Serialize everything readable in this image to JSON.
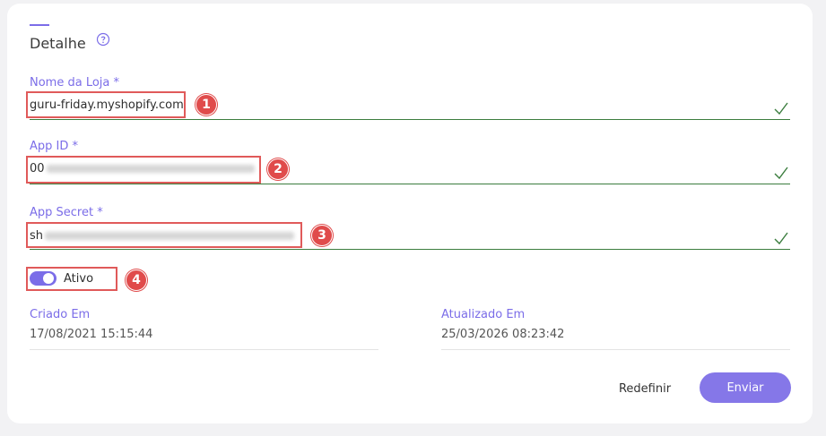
{
  "section": {
    "title": "Detalhe"
  },
  "fields": {
    "store_name": {
      "label": "Nome da Loja *",
      "value": "guru-friday.myshopify.com"
    },
    "app_id": {
      "label": "App ID *",
      "value_prefix": "00"
    },
    "app_secret": {
      "label": "App Secret *",
      "value_prefix": "sh"
    }
  },
  "toggle": {
    "label": "Ativo",
    "checked": true
  },
  "meta": {
    "created": {
      "label": "Criado Em",
      "value": "17/08/2021 15:15:44"
    },
    "updated": {
      "label": "Atualizado Em",
      "value": "25/03/2026 08:23:42"
    }
  },
  "annotations": [
    "1",
    "2",
    "3",
    "4"
  ],
  "buttons": {
    "reset": "Redefinir",
    "submit": "Enviar"
  },
  "colors": {
    "accent": "#7b6de8",
    "valid": "#3b7d3e",
    "annotation": "#e04b4b"
  }
}
